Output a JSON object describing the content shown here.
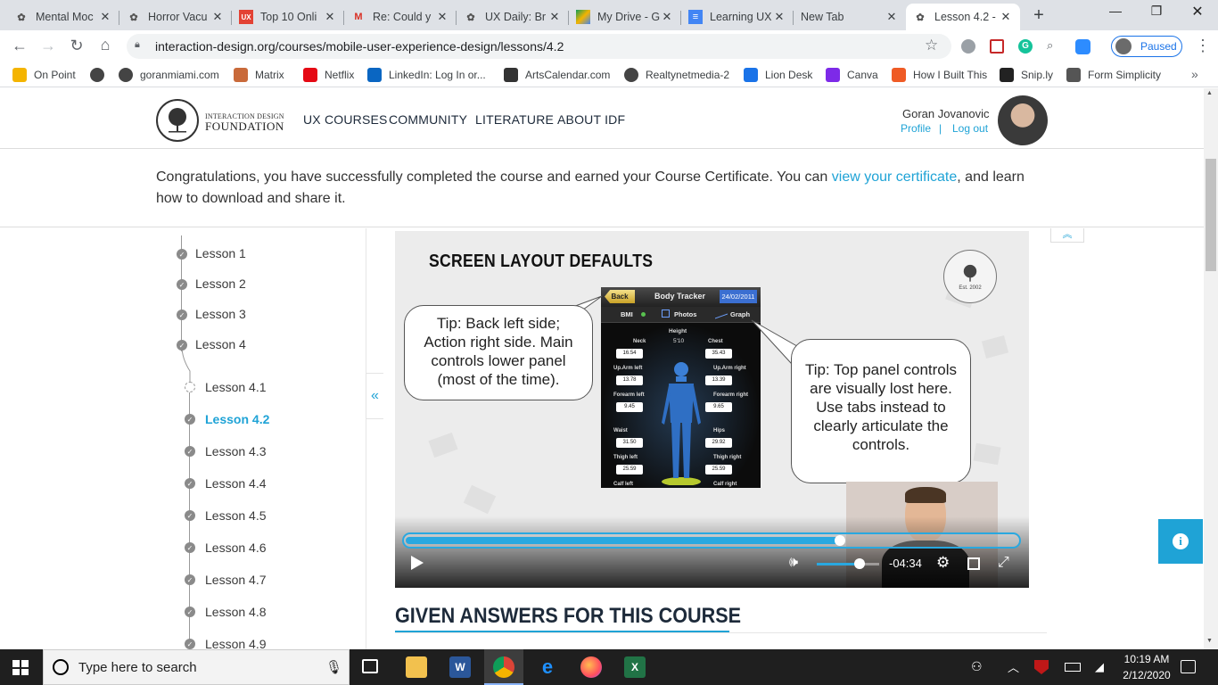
{
  "browser": {
    "tabs": [
      {
        "title": "Mental Moc",
        "icon": "idf-icon"
      },
      {
        "title": "Horror Vacu",
        "icon": "idf-icon"
      },
      {
        "title": "Top 10 Onli",
        "icon": "ux-icon"
      },
      {
        "title": "Re: Could y",
        "icon": "gmail-icon"
      },
      {
        "title": "UX Daily: Br",
        "icon": "idf-icon"
      },
      {
        "title": "My Drive - G",
        "icon": "drive-icon"
      },
      {
        "title": "Learning UX",
        "icon": "docs-icon"
      },
      {
        "title": "New Tab",
        "icon": ""
      },
      {
        "title": "Lesson 4.2 -",
        "icon": "idf-icon"
      }
    ],
    "url": "interaction-design.org/courses/mobile-user-experience-design/lessons/4.2",
    "profile_status": "Paused",
    "bookmarks": [
      {
        "label": "On Point",
        "color": "#f4b400"
      },
      {
        "label": "",
        "color": "#444444"
      },
      {
        "label": "goranmiami.com",
        "color": "#444444"
      },
      {
        "label": "Matrix",
        "color": "#c96a3a"
      },
      {
        "label": "Netflix",
        "color": "#e50914"
      },
      {
        "label": "LinkedIn: Log In or...",
        "color": "#0a66c2"
      },
      {
        "label": "ArtsCalendar.com",
        "color": "#333333"
      },
      {
        "label": "Realtynetmedia-2",
        "color": "#444444"
      },
      {
        "label": "Lion Desk",
        "color": "#1a73e8"
      },
      {
        "label": "Canva",
        "color": "#7d2ae8"
      },
      {
        "label": "How I Built This",
        "color": "#ef5b25"
      },
      {
        "label": "Snip.ly",
        "color": "#222222"
      },
      {
        "label": "Form Simplicity",
        "color": "#555555"
      }
    ]
  },
  "site": {
    "logo_line1": "INTERACTION DESIGN",
    "logo_line2": "FOUNDATION",
    "logo_est": "Est. 2002",
    "nav": [
      "UX COURSES",
      "COMMUNITY",
      "LITERATURE",
      "ABOUT IDF"
    ],
    "user_name": "Goran Jovanovic",
    "profile_link": "Profile",
    "logout_link": "Log out",
    "link_separator": "|"
  },
  "banner": {
    "text_before": "Congratulations, you have successfully completed the course and earned your Course Certificate. You can ",
    "link": "view your certificate",
    "text_after": ", and learn how to download and share it."
  },
  "sidebar": {
    "lessons": [
      "Lesson 1",
      "Lesson 2",
      "Lesson 3",
      "Lesson 4"
    ],
    "sublessons": [
      "Lesson 4.1",
      "Lesson 4.2",
      "Lesson 4.3",
      "Lesson 4.4",
      "Lesson 4.5",
      "Lesson 4.6",
      "Lesson 4.7",
      "Lesson 4.8",
      "Lesson 4.9"
    ],
    "active": "Lesson 4.2",
    "collapse_glyph": "«"
  },
  "video": {
    "slide_title": "SCREEN LAYOUT DEFAULTS",
    "tip_left": "Tip: Back left side; Action right side. Main controls lower panel (most of the time).",
    "tip_right": "Tip: Top panel controls are visually lost here. Use tabs instead to clearly articulate the controls.",
    "phone": {
      "back": "Back",
      "title": "Body Tracker",
      "date": "24/02/2011",
      "tabs": [
        "BMI",
        "Photos",
        "Graph"
      ],
      "height_label": "Height",
      "height_value": "5'10",
      "fields": [
        {
          "label": "Neck",
          "value": "16.54"
        },
        {
          "label": "Chest",
          "value": "35.43"
        },
        {
          "label": "Up.Arm left",
          "value": "13.78"
        },
        {
          "label": "Up.Arm right",
          "value": "13.39"
        },
        {
          "label": "Forearm left",
          "value": "9.45"
        },
        {
          "label": "Forearm right",
          "value": "9.65"
        },
        {
          "label": "Waist",
          "value": "31.50"
        },
        {
          "label": "Hips",
          "value": "29.92"
        },
        {
          "label": "Thigh left",
          "value": "25.59"
        },
        {
          "label": "Thigh right",
          "value": "25.59"
        },
        {
          "label": "Calf left",
          "value": ""
        },
        {
          "label": "Calf right",
          "value": ""
        }
      ]
    },
    "progress": 0.71,
    "volume": 0.68,
    "time_remaining": "-04:34",
    "stamp_text": "Est. 2002"
  },
  "section_heading": "GIVEN ANSWERS FOR THIS COURSE",
  "taskbar": {
    "search_placeholder": "Type here to search",
    "time": "10:19 AM",
    "date": "2/12/2020"
  },
  "colors": {
    "accent": "#1fa3d6",
    "chrome_tabs": "#dee1e6",
    "taskbar": "#1f1f1f"
  }
}
